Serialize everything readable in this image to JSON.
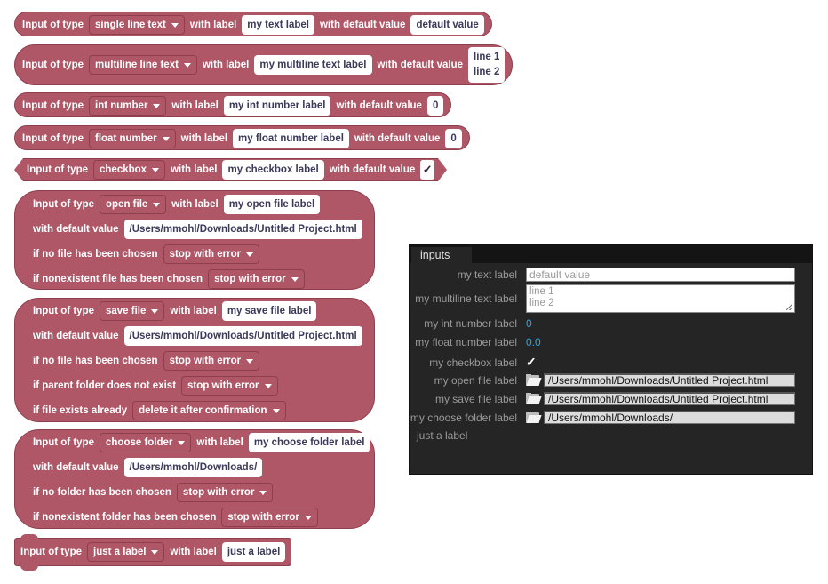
{
  "blocks": {
    "common": {
      "input_of_type": "Input of type",
      "with_label": "with label",
      "with_default_value": "with default value"
    },
    "single_line": {
      "type": "single line text",
      "label": "my text label",
      "default": "default value"
    },
    "multiline": {
      "type": "multiline line text",
      "label": "my multiline text label",
      "default_lines": [
        "line 1",
        "line 2"
      ]
    },
    "int_number": {
      "type": "int number",
      "label": "my int number label",
      "default": "0"
    },
    "float_number": {
      "type": "float number",
      "label": "my float number label",
      "default": "0"
    },
    "checkbox": {
      "type": "checkbox",
      "label": "my checkbox label",
      "default": "✓"
    },
    "open_file": {
      "type": "open file",
      "label": "my open file label",
      "default": "/Users/mmohl/Downloads/Untitled Project.html",
      "no_file_text": "if no file has been chosen",
      "no_file_action": "stop with error",
      "nonexistent_text": "if nonexistent file has been chosen",
      "nonexistent_action": "stop with error"
    },
    "save_file": {
      "type": "save file",
      "label": "my save file label",
      "default": "/Users/mmohl/Downloads/Untitled Project.html",
      "no_file_text": "if no file has been chosen",
      "no_file_action": "stop with error",
      "parent_missing_text": "if parent folder does not exist",
      "parent_missing_action": "stop with error",
      "exists_text": "if file exists already",
      "exists_action": "delete it after confirmation"
    },
    "choose_folder": {
      "type": "choose folder",
      "label": "my choose folder label",
      "default": "/Users/mmohl/Downloads/",
      "no_folder_text": "if no folder has been chosen",
      "no_folder_action": "stop with error",
      "nonexistent_text": "if nonexistent folder has been chosen",
      "nonexistent_action": "stop with error"
    },
    "just_label": {
      "type": "just a label",
      "label": "just a label"
    }
  },
  "panel": {
    "tab": "inputs",
    "rows": {
      "text": {
        "label": "my text label",
        "value": "default value"
      },
      "multiline": {
        "label": "my multiline text label",
        "lines": [
          "line 1",
          "line 2"
        ]
      },
      "int": {
        "label": "my int number label",
        "value": "0"
      },
      "float": {
        "label": "my float number label",
        "value": "0.0"
      },
      "checkbox": {
        "label": "my checkbox label",
        "value": "✓"
      },
      "open_file": {
        "label": "my open file label",
        "value": "/Users/mmohl/Downloads/Untitled Project.html"
      },
      "save_file": {
        "label": "my save file label",
        "value": "/Users/mmohl/Downloads/Untitled Project.html"
      },
      "choose_folder": {
        "label": "my choose folder label",
        "value": "/Users/mmohl/Downloads/"
      },
      "just_label": {
        "label": "just a label"
      }
    },
    "colors": {
      "number": "#29a8e0",
      "background": "#252525"
    }
  },
  "colors": {
    "block": "#b05767",
    "block_border": "#8e3f4e"
  }
}
